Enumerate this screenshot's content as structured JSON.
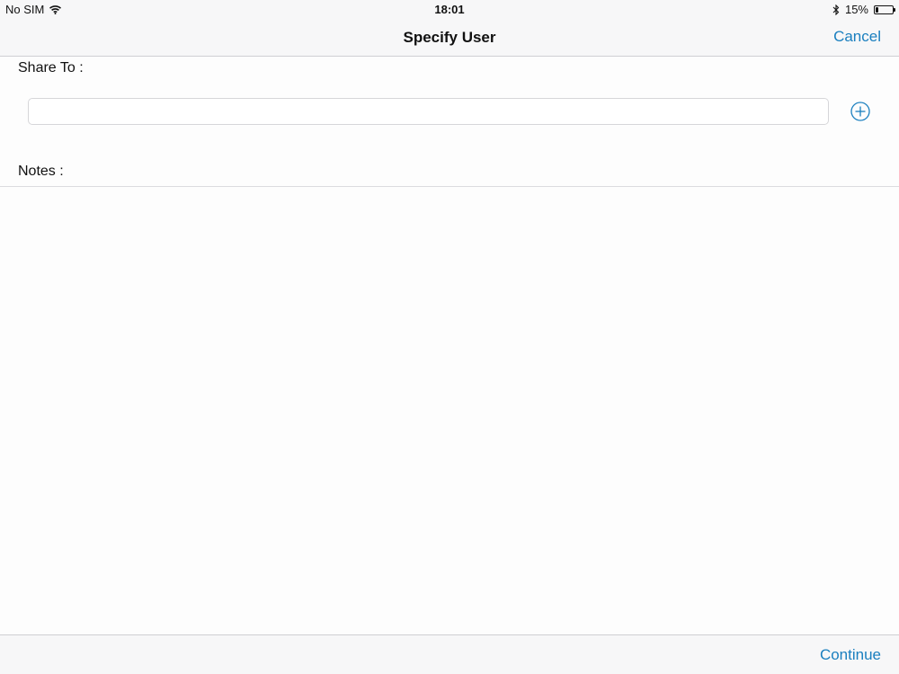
{
  "status_bar": {
    "carrier": "No SIM",
    "time": "18:01",
    "battery_percent": "15%",
    "battery_level": 0.15,
    "icons": [
      "wifi-icon",
      "bluetooth-icon",
      "battery-icon"
    ]
  },
  "nav_bar": {
    "title": "Specify User",
    "cancel_label": "Cancel"
  },
  "form": {
    "share_to_label": "Share To :",
    "share_to_value": "",
    "add_icon": "plus-circle-icon",
    "notes_label": "Notes :",
    "notes_value": ""
  },
  "toolbar": {
    "continue_label": "Continue"
  },
  "colors": {
    "accent": "#1a7fbf",
    "bar_background": "#f7f7f8",
    "content_background": "#fdfdfd"
  }
}
